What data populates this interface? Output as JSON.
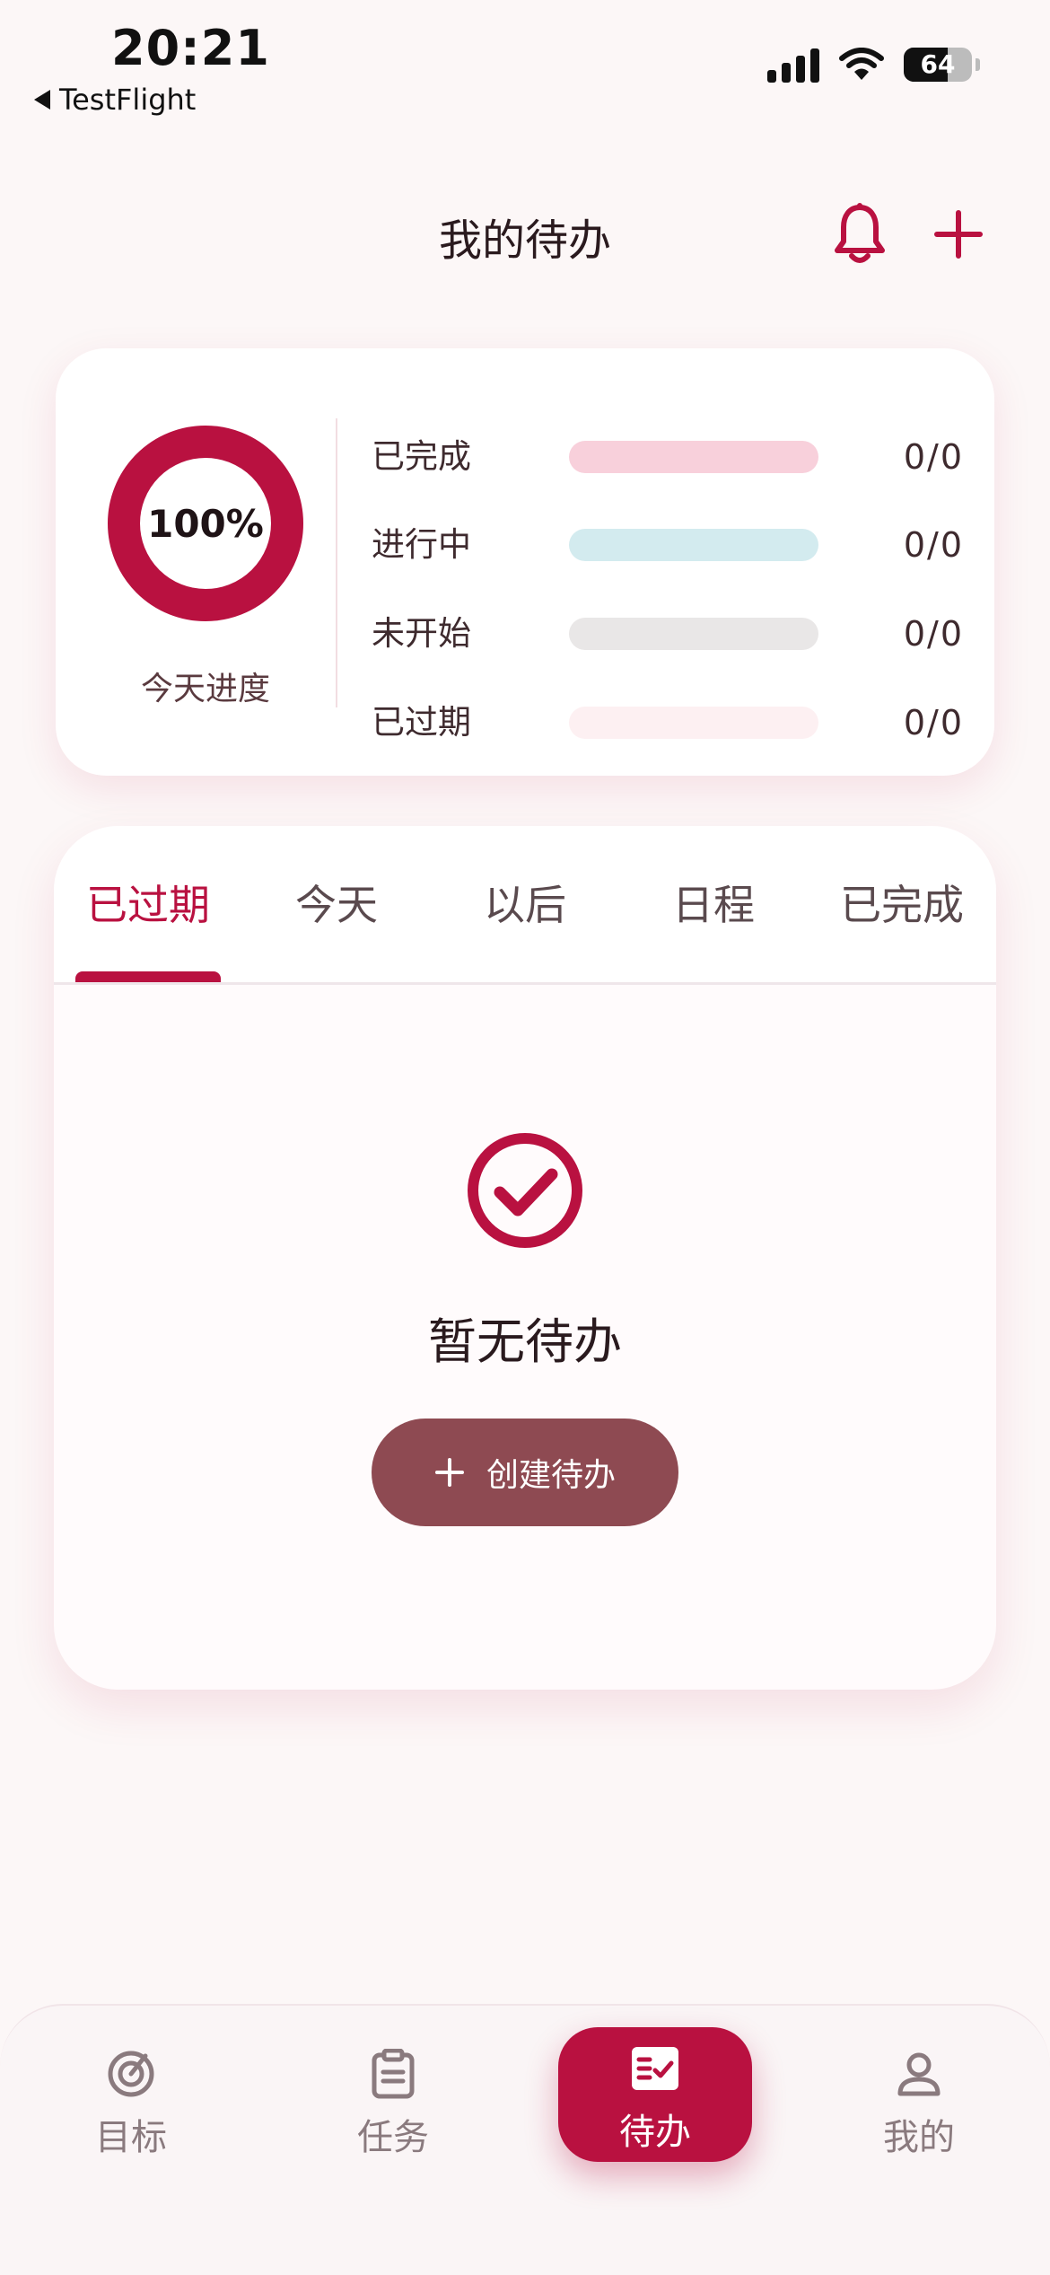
{
  "status_bar": {
    "time": "20:21",
    "back_label": "TestFlight",
    "battery_percent": 64,
    "battery_label": "64"
  },
  "header": {
    "title": "我的待办"
  },
  "icons": {
    "bell": "bell-icon",
    "add": "plus-icon"
  },
  "colors": {
    "accent": "#b91140",
    "button": "#8e4a52",
    "bg": "#fcf7f7"
  },
  "stats": {
    "progress_percent": 100,
    "progress_label": "100%",
    "progress_caption": "今天进度",
    "rows": [
      {
        "label": "已完成",
        "value": "0/0",
        "color": "#f8d0db",
        "fill": 0
      },
      {
        "label": "进行中",
        "value": "0/0",
        "color": "#d3ebef",
        "fill": 0
      },
      {
        "label": "未开始",
        "value": "0/0",
        "color": "#e9e7e7",
        "fill": 0
      },
      {
        "label": "已过期",
        "value": "0/0",
        "color": "#fdf0f2",
        "fill": 0
      }
    ]
  },
  "tabs": [
    {
      "label": "已过期",
      "active": true
    },
    {
      "label": "今天",
      "active": false
    },
    {
      "label": "以后",
      "active": false
    },
    {
      "label": "日程",
      "active": false
    },
    {
      "label": "已完成",
      "active": false
    }
  ],
  "empty_state": {
    "message": "暂无待办",
    "button_label": "创建待办"
  },
  "bottom_nav": [
    {
      "label": "目标",
      "icon": "target-icon",
      "active": false
    },
    {
      "label": "任务",
      "icon": "clipboard-icon",
      "active": false
    },
    {
      "label": "待办",
      "icon": "checklist-icon",
      "active": true
    },
    {
      "label": "我的",
      "icon": "user-icon",
      "active": false
    }
  ]
}
